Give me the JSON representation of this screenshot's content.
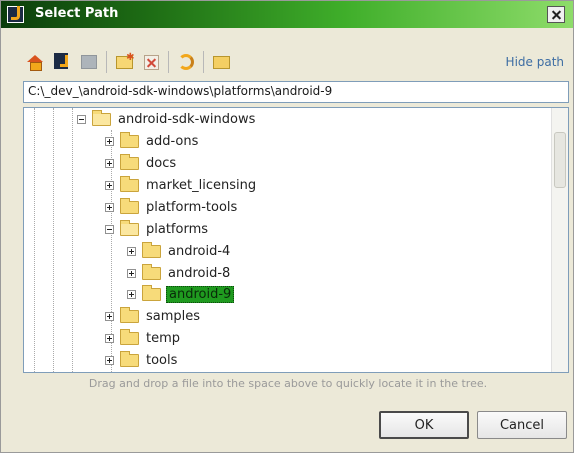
{
  "window": {
    "title": "Select Path"
  },
  "toolbar": {
    "buttons": [
      {
        "icon": "home-icon"
      },
      {
        "icon": "project-icon"
      },
      {
        "icon": "module-icon"
      },
      {
        "icon": "new-folder-icon"
      },
      {
        "icon": "delete-icon"
      },
      {
        "icon": "refresh-icon"
      },
      {
        "icon": "folder-icon"
      }
    ],
    "hide_path_label": "Hide path"
  },
  "path_field": {
    "value": "C:\\_dev_\\android-sdk-windows\\platforms\\android-9"
  },
  "tree": {
    "nodes": [
      {
        "label": "android-sdk-windows",
        "level": 0,
        "expanded": true
      },
      {
        "label": "add-ons",
        "level": 1,
        "expanded": false
      },
      {
        "label": "docs",
        "level": 1,
        "expanded": false
      },
      {
        "label": "market_licensing",
        "level": 1,
        "expanded": false
      },
      {
        "label": "platform-tools",
        "level": 1,
        "expanded": false
      },
      {
        "label": "platforms",
        "level": 1,
        "expanded": true
      },
      {
        "label": "android-4",
        "level": 2,
        "expanded": false
      },
      {
        "label": "android-8",
        "level": 2,
        "expanded": false
      },
      {
        "label": "android-9",
        "level": 2,
        "expanded": false,
        "selected": true
      },
      {
        "label": "samples",
        "level": 1,
        "expanded": false
      },
      {
        "label": "temp",
        "level": 1,
        "expanded": false
      },
      {
        "label": "tools",
        "level": 1,
        "expanded": false
      }
    ]
  },
  "hint": "Drag and drop a file into the space above to quickly locate it in the tree.",
  "buttons": {
    "ok": "OK",
    "cancel": "Cancel"
  },
  "colors": {
    "selection": "#1f9a1f",
    "link": "#3d6da3",
    "titlebar_start": "#0b3d0b",
    "titlebar_end": "#8edc6a"
  }
}
